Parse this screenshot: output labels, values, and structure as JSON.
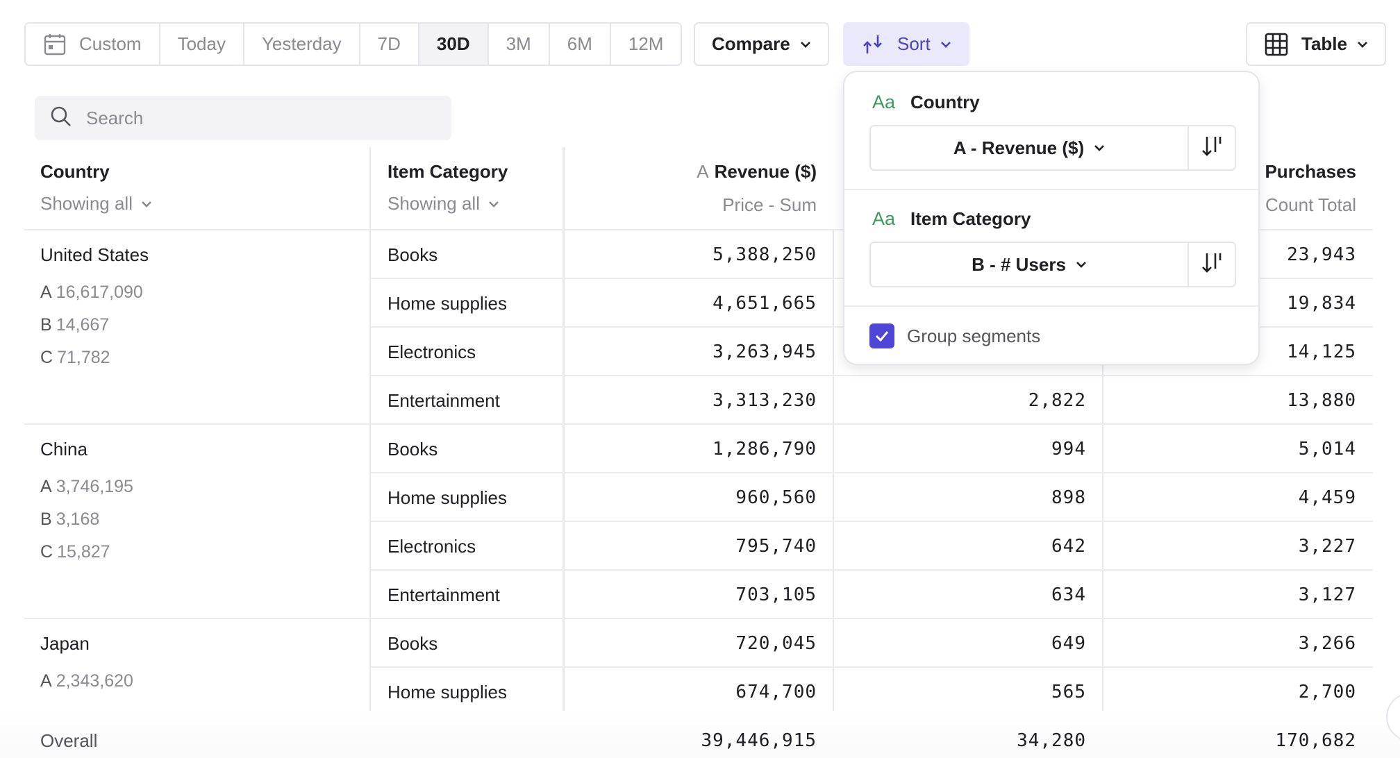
{
  "toolbar": {
    "ranges": [
      {
        "label": "Custom",
        "icon": "calendar-icon"
      },
      {
        "label": "Today"
      },
      {
        "label": "Yesterday"
      },
      {
        "label": "7D"
      },
      {
        "label": "30D",
        "active": true
      },
      {
        "label": "3M"
      },
      {
        "label": "6M"
      },
      {
        "label": "12M"
      }
    ],
    "compare_label": "Compare",
    "sort_label": "Sort",
    "table_label": "Table"
  },
  "search": {
    "placeholder": "Search"
  },
  "table": {
    "headers": {
      "country": {
        "title": "Country",
        "filter": "Showing all"
      },
      "category": {
        "title": "Item Category",
        "filter": "Showing all"
      },
      "revenue": {
        "letter": "A",
        "title": "Revenue ($)",
        "sub": "Price - Sum"
      },
      "purchases": {
        "title": "# Purchases",
        "sub": "Count Total"
      }
    },
    "groups": [
      {
        "country": "United States",
        "stats": [
          {
            "l": "A",
            "v": "16,617,090"
          },
          {
            "l": "B",
            "v": "14,667"
          },
          {
            "l": "C",
            "v": "71,782"
          }
        ],
        "rows": [
          {
            "category": "Books",
            "revenue": "5,388,250",
            "users": "",
            "purchases": "23,943"
          },
          {
            "category": "Home supplies",
            "revenue": "4,651,665",
            "users": "",
            "purchases": "19,834"
          },
          {
            "category": "Electronics",
            "revenue": "3,263,945",
            "users": "",
            "purchases": "14,125"
          },
          {
            "category": "Entertainment",
            "revenue": "3,313,230",
            "users": "2,822",
            "purchases": "13,880"
          }
        ]
      },
      {
        "country": "China",
        "stats": [
          {
            "l": "A",
            "v": "3,746,195"
          },
          {
            "l": "B",
            "v": "3,168"
          },
          {
            "l": "C",
            "v": "15,827"
          }
        ],
        "rows": [
          {
            "category": "Books",
            "revenue": "1,286,790",
            "users": "994",
            "purchases": "5,014"
          },
          {
            "category": "Home supplies",
            "revenue": "960,560",
            "users": "898",
            "purchases": "4,459"
          },
          {
            "category": "Electronics",
            "revenue": "795,740",
            "users": "642",
            "purchases": "3,227"
          },
          {
            "category": "Entertainment",
            "revenue": "703,105",
            "users": "634",
            "purchases": "3,127"
          }
        ]
      },
      {
        "country": "Japan",
        "stats": [
          {
            "l": "A",
            "v": "2,343,620"
          }
        ],
        "rows": [
          {
            "category": "Books",
            "revenue": "720,045",
            "users": "649",
            "purchases": "3,266"
          },
          {
            "category": "Home supplies",
            "revenue": "674,700",
            "users": "565",
            "purchases": "2,700"
          }
        ]
      }
    ],
    "overall": {
      "label": "Overall",
      "revenue": "39,446,915",
      "users": "34,280",
      "purchases": "170,682"
    }
  },
  "sort_popup": {
    "items": [
      {
        "label": "Country",
        "type_icon": "Aa",
        "value": "A - Revenue ($)"
      },
      {
        "label": "Item Category",
        "type_icon": "Aa",
        "value": "B - # Users"
      }
    ],
    "group_segments_label": "Group segments",
    "group_segments_checked": true
  },
  "colors": {
    "accent": "#4f46d8",
    "sort_bg": "#e9e9fb",
    "type_icon": "#3b9b5e"
  }
}
